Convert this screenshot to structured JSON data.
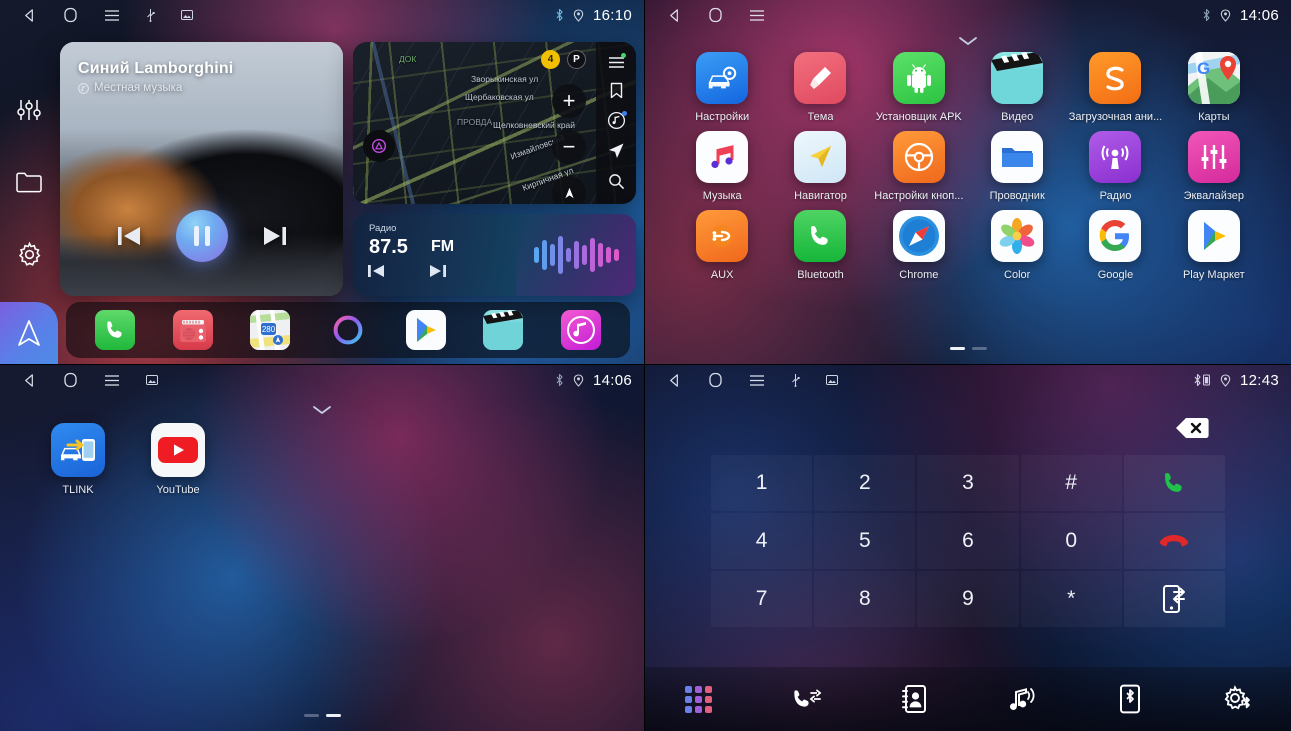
{
  "panes": {
    "home": {
      "status": {
        "time": "16:10",
        "icons": [
          "back-icon",
          "home-icon",
          "menu-icon",
          "usb-icon",
          "sdcard-icon"
        ],
        "right_icons": [
          "bluetooth-icon",
          "location-icon"
        ]
      },
      "sidebar": [
        {
          "name": "equalizer-icon",
          "label": "Эквалайзер"
        },
        {
          "name": "folder-icon",
          "label": "Проводник"
        },
        {
          "name": "gear-icon",
          "label": "Настройки"
        },
        {
          "name": "navigation-icon",
          "label": "Навигация"
        }
      ],
      "player": {
        "title": "Синий Lamborghini",
        "subtitle": "Местная музыка",
        "source_icon": "local-music-icon",
        "prev_label": "Предыдущий",
        "play_state": "pause",
        "next_label": "Следующий"
      },
      "map": {
        "traffic_level": "4",
        "parking_label": "P",
        "zoom_in": "+",
        "zoom_out": "−",
        "labels": [
          "Зворыкинская ул",
          "Щербаковская ул",
          "Измайловский",
          "Кирпичная ул",
          "ДОК",
          "ПРОВДА",
          "Щелковневский край"
        ],
        "rail_icons": [
          "menu-icon",
          "bookmark-icon",
          "music-disc-icon",
          "navigate-icon",
          "search-icon"
        ]
      },
      "radio": {
        "label": "Радио",
        "frequency": "87.5",
        "band": "FM",
        "prev_label": "Предыдущая станция",
        "next_label": "Следующая станция"
      },
      "dock": [
        {
          "name": "phone",
          "label": "Телефон"
        },
        {
          "name": "radio",
          "label": "Радио"
        },
        {
          "name": "maps",
          "label": "Карты"
        },
        {
          "name": "siri",
          "label": "Голосовой помощник"
        },
        {
          "name": "playstore",
          "label": "Play Маркет"
        },
        {
          "name": "video",
          "label": "Видео"
        },
        {
          "name": "music",
          "label": "Музыка"
        }
      ]
    },
    "drawer": {
      "status": {
        "time": "14:06",
        "icons": [
          "back-icon",
          "home-icon",
          "menu-icon"
        ],
        "right_icons": [
          "bluetooth-icon",
          "location-icon"
        ]
      },
      "chevron": "chevron-down-icon",
      "apps": [
        {
          "label": "Настройки",
          "icon": "car-settings"
        },
        {
          "label": "Тема",
          "icon": "theme-brush"
        },
        {
          "label": "Установщик APK",
          "icon": "android-robot"
        },
        {
          "label": "Видео",
          "icon": "clapperboard"
        },
        {
          "label": "Загрузочная ани...",
          "icon": "boot-anim"
        },
        {
          "label": "Карты",
          "icon": "google-maps"
        },
        {
          "label": "Музыка",
          "icon": "apple-music-notes"
        },
        {
          "label": "Навигатор",
          "icon": "navigator-arrow"
        },
        {
          "label": "Настройки кноп...",
          "icon": "steering-wheel"
        },
        {
          "label": "Проводник",
          "icon": "folder-blue"
        },
        {
          "label": "Радио",
          "icon": "podcast-antenna"
        },
        {
          "label": "Эквалайзер",
          "icon": "eq-sliders"
        },
        {
          "label": "AUX",
          "icon": "aux-plug"
        },
        {
          "label": "Bluetooth",
          "icon": "phone-green"
        },
        {
          "label": "Chrome",
          "icon": "safari-compass"
        },
        {
          "label": "Color",
          "icon": "color-flower"
        },
        {
          "label": "Google",
          "icon": "google-g"
        },
        {
          "label": "Play Маркет",
          "icon": "play-store"
        }
      ],
      "pages": {
        "count": 2,
        "active": 1
      }
    },
    "home2": {
      "status": {
        "time": "14:06",
        "icons": [
          "back-icon",
          "home-icon",
          "menu-icon",
          "sdcard-icon"
        ],
        "right_icons": [
          "bluetooth-icon",
          "location-icon"
        ]
      },
      "chevron": "chevron-down-icon",
      "apps": [
        {
          "label": "TLINK",
          "icon": "tlink-carplay"
        },
        {
          "label": "YouTube",
          "icon": "youtube"
        }
      ],
      "pages": {
        "count": 2,
        "active": 2
      }
    },
    "dialer": {
      "status": {
        "time": "12:43",
        "icons": [
          "back-icon",
          "home-icon",
          "menu-icon",
          "usb-icon",
          "sdcard-icon"
        ],
        "right_icons": [
          "bluetooth-battery-icon",
          "location-icon"
        ]
      },
      "number_value": "",
      "number_placeholder": "",
      "backspace_label": "backspace-icon",
      "keys": [
        {
          "label": "1",
          "name": "key-1"
        },
        {
          "label": "2",
          "name": "key-2"
        },
        {
          "label": "3",
          "name": "key-3"
        },
        {
          "label": "#",
          "name": "key-hash"
        },
        {
          "label": "",
          "name": "call-button"
        },
        {
          "label": "4",
          "name": "key-4"
        },
        {
          "label": "5",
          "name": "key-5"
        },
        {
          "label": "6",
          "name": "key-6"
        },
        {
          "label": "0",
          "name": "key-0"
        },
        {
          "label": "",
          "name": "hangup-button"
        },
        {
          "label": "7",
          "name": "key-7"
        },
        {
          "label": "8",
          "name": "key-8"
        },
        {
          "label": "9",
          "name": "key-9"
        },
        {
          "label": "*",
          "name": "key-star"
        },
        {
          "label": "",
          "name": "transfer-audio-button"
        }
      ],
      "toolbar": [
        {
          "name": "keypad-icon",
          "label": "Клавиатура",
          "active": true
        },
        {
          "name": "call-log-icon",
          "label": "Журнал вызовов",
          "active": false
        },
        {
          "name": "contacts-icon",
          "label": "Контакты",
          "active": false
        },
        {
          "name": "bt-music-icon",
          "label": "Музыка",
          "active": false
        },
        {
          "name": "bt-device-icon",
          "label": "Устройство",
          "active": false
        },
        {
          "name": "bt-settings-icon",
          "label": "Настройки",
          "active": false
        }
      ]
    }
  },
  "colors": {
    "call_green": "#1fc24a",
    "hangup_red": "#e0282a",
    "accent_blue": "#4d8be6",
    "accent_purple": "#8a6fe4",
    "radio_amber": "#f2c000"
  }
}
